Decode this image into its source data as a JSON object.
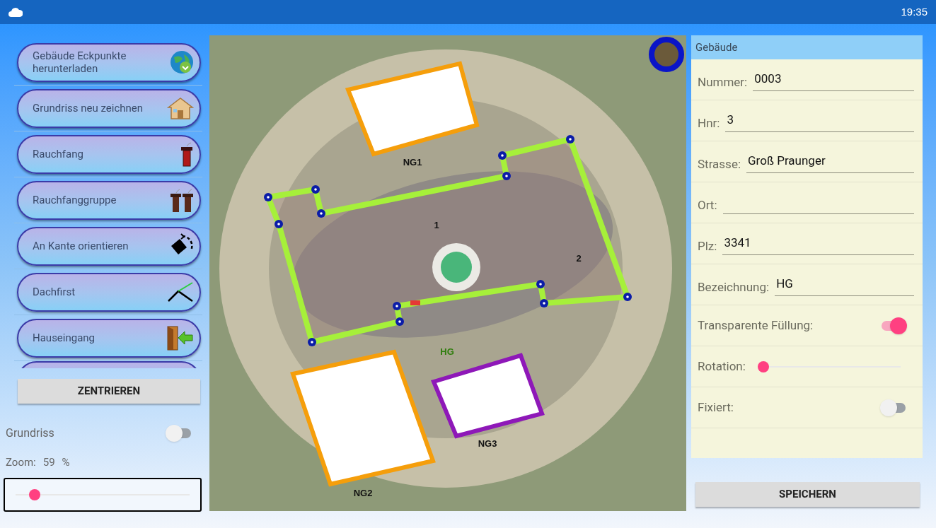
{
  "status_bar": {
    "time": "19:35"
  },
  "tools": [
    {
      "label": "Gebäude Eckpunkte\nherunterladen",
      "kind": "globe"
    },
    {
      "label": "Grundriss neu zeichnen",
      "kind": "house"
    },
    {
      "label": "Rauchfang",
      "kind": "chimney"
    },
    {
      "label": "Rauchfanggruppe",
      "kind": "chimneys"
    },
    {
      "label": "An Kante orientieren",
      "kind": "rotate"
    },
    {
      "label": "Dachfirst",
      "kind": "roof"
    },
    {
      "label": "Hauseingang",
      "kind": "door"
    }
  ],
  "center_button": "ZENTRIEREN",
  "floor_plan": {
    "label": "Grundriss",
    "on": false
  },
  "zoom": {
    "label": "Zoom:",
    "value": "59",
    "unit": "%",
    "level": 0.11
  },
  "map": {
    "labels": [
      {
        "text": "NG1",
        "kind": "outbuilding"
      },
      {
        "text": "NG2",
        "kind": "outbuilding"
      },
      {
        "text": "NG3",
        "kind": "outbuilding"
      },
      {
        "text": "HG",
        "kind": "main"
      },
      {
        "text": "1",
        "kind": "roof"
      },
      {
        "text": "2",
        "kind": "roof"
      }
    ]
  },
  "panel": {
    "title": "Gebäude",
    "rows": [
      {
        "kind": "text",
        "label": "Nummer:",
        "value": "0003"
      },
      {
        "kind": "text",
        "label": "Hnr:",
        "value": "3"
      },
      {
        "kind": "text",
        "label": "Strasse:",
        "value": "Groß Praunger"
      },
      {
        "kind": "text",
        "label": "Ort:"
      },
      {
        "kind": "text",
        "label": "Plz:",
        "value": "3341"
      },
      {
        "kind": "text",
        "label": "Bezeichnung:",
        "value": "HG"
      },
      {
        "kind": "toggle",
        "label": "Transparente Füllung:",
        "on": true
      },
      {
        "kind": "slider",
        "label": "Rotation:",
        "level": 0
      },
      {
        "kind": "toggle",
        "label": "Fixiert:",
        "on": false
      }
    ]
  },
  "save_button": "SPEICHERN"
}
